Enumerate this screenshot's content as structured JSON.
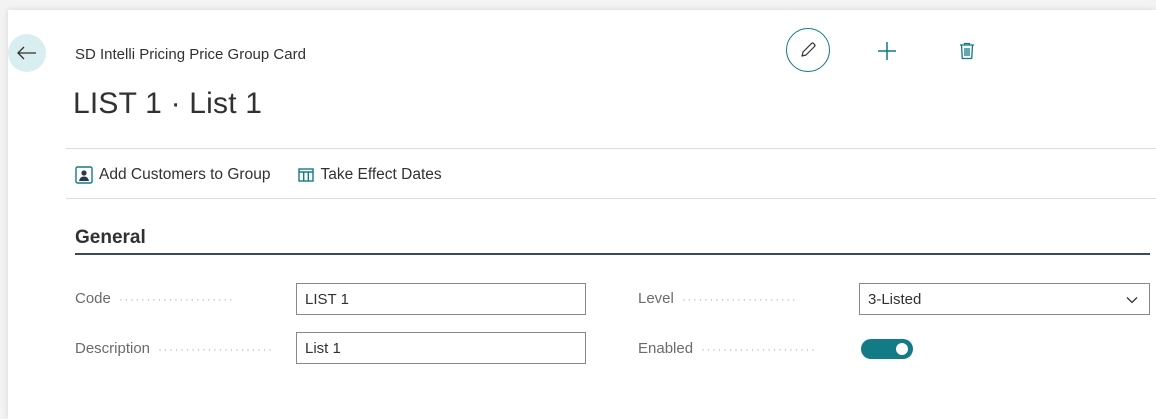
{
  "header": {
    "subtitle": "SD Intelli Pricing Price Group Card",
    "title": "LIST 1 · List 1"
  },
  "actions": [
    {
      "label": "Add Customers to Group",
      "icon": "customer-group-icon"
    },
    {
      "label": "Take Effect Dates",
      "icon": "calendar-grid-icon"
    }
  ],
  "section": {
    "title": "General"
  },
  "fields": {
    "code": {
      "label": "Code",
      "value": "LIST 1"
    },
    "description": {
      "label": "Description",
      "value": "List 1"
    },
    "level": {
      "label": "Level",
      "value": "3-Listed"
    },
    "enabled": {
      "label": "Enabled",
      "value": true
    }
  },
  "colors": {
    "accent": "#127b86",
    "back_button_bg": "#d9eef0"
  }
}
